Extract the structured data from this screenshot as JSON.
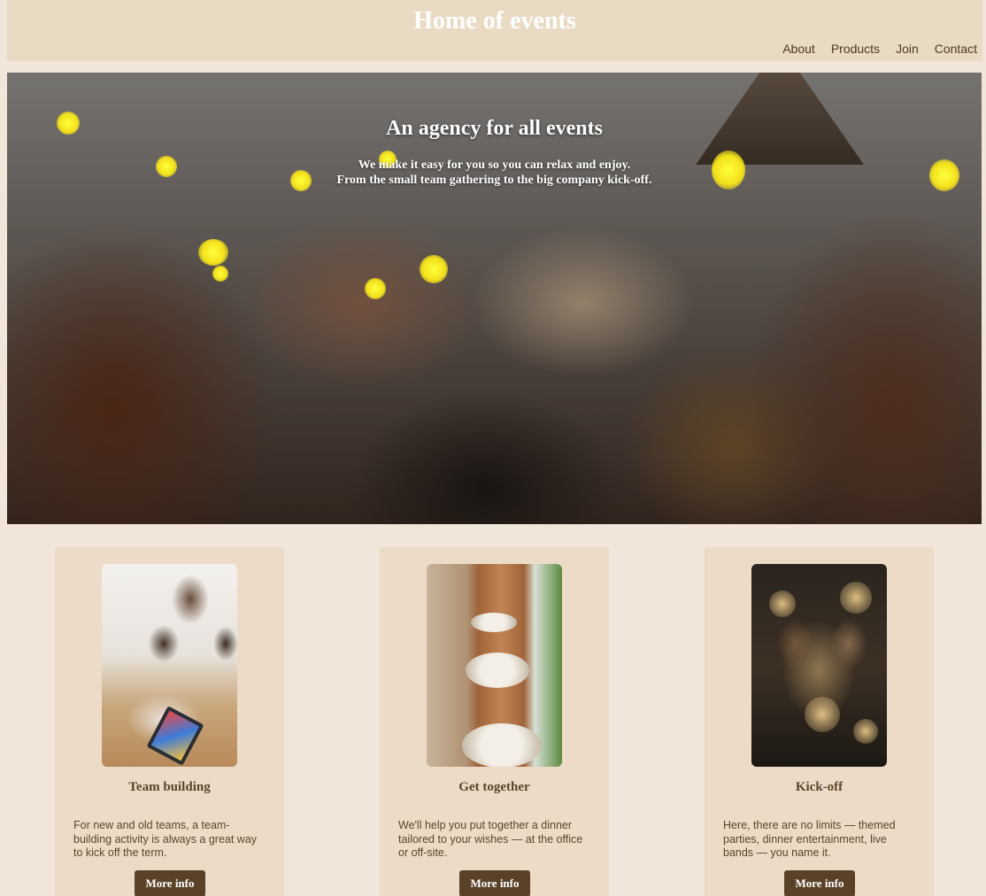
{
  "header": {
    "title": "Home of events",
    "nav": [
      "About",
      "Products",
      "Join",
      "Contact"
    ]
  },
  "hero": {
    "title": "An agency for all events",
    "subtitle_line1": "We make it easy for you so you can relax and enjoy.",
    "subtitle_line2": "From the small team gathering to the big company kick-off."
  },
  "cards": [
    {
      "title": "Team building",
      "text": "For new and old teams, a team-building activity is always a great way to kick off the term.",
      "button": "More info"
    },
    {
      "title": "Get together",
      "text": "We'll help you put together a dinner tailored to your wishes — at the office or off-site.",
      "button": "More info"
    },
    {
      "title": "Kick-off",
      "text": "Here, there are no limits — themed parties, dinner entertainment, live bands — you name it.",
      "button": "More info"
    }
  ],
  "colors": {
    "background": "#f1e6d9",
    "header": "#e9dac4",
    "card": "#ecdcc7",
    "button": "#5a4228",
    "text": "#5a452a"
  }
}
